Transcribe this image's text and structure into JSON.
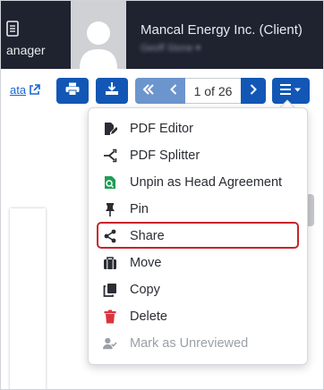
{
  "header": {
    "nav_label": "anager",
    "client_name": "Mancal Energy Inc. (Client)",
    "client_sub": "Geoff Stone ▾"
  },
  "toolbar": {
    "link_text": "ata",
    "page_indicator": "1 of 26"
  },
  "menu": {
    "items": [
      {
        "label": "PDF Editor",
        "icon": "pdf-edit-icon",
        "color": "#2a2d33"
      },
      {
        "label": "PDF Splitter",
        "icon": "split-icon",
        "color": "#2a2d33"
      },
      {
        "label": "Unpin as Head Agreement",
        "icon": "unpin-doc-icon",
        "color": "#1f9d55"
      },
      {
        "label": "Pin",
        "icon": "pin-icon",
        "color": "#2a2d33"
      },
      {
        "label": "Share",
        "icon": "share-icon",
        "color": "#2a2d33"
      },
      {
        "label": "Move",
        "icon": "briefcase-icon",
        "color": "#2a2d33"
      },
      {
        "label": "Copy",
        "icon": "copy-icon",
        "color": "#2a2d33"
      },
      {
        "label": "Delete",
        "icon": "trash-icon",
        "color": "#d9343d"
      },
      {
        "label": "Mark as Unreviewed",
        "icon": "user-check-icon",
        "color": "#9aa0a8"
      }
    ]
  },
  "colors": {
    "header_bg": "#1f2330",
    "primary": "#1257b5",
    "highlight": "#c8232c"
  }
}
